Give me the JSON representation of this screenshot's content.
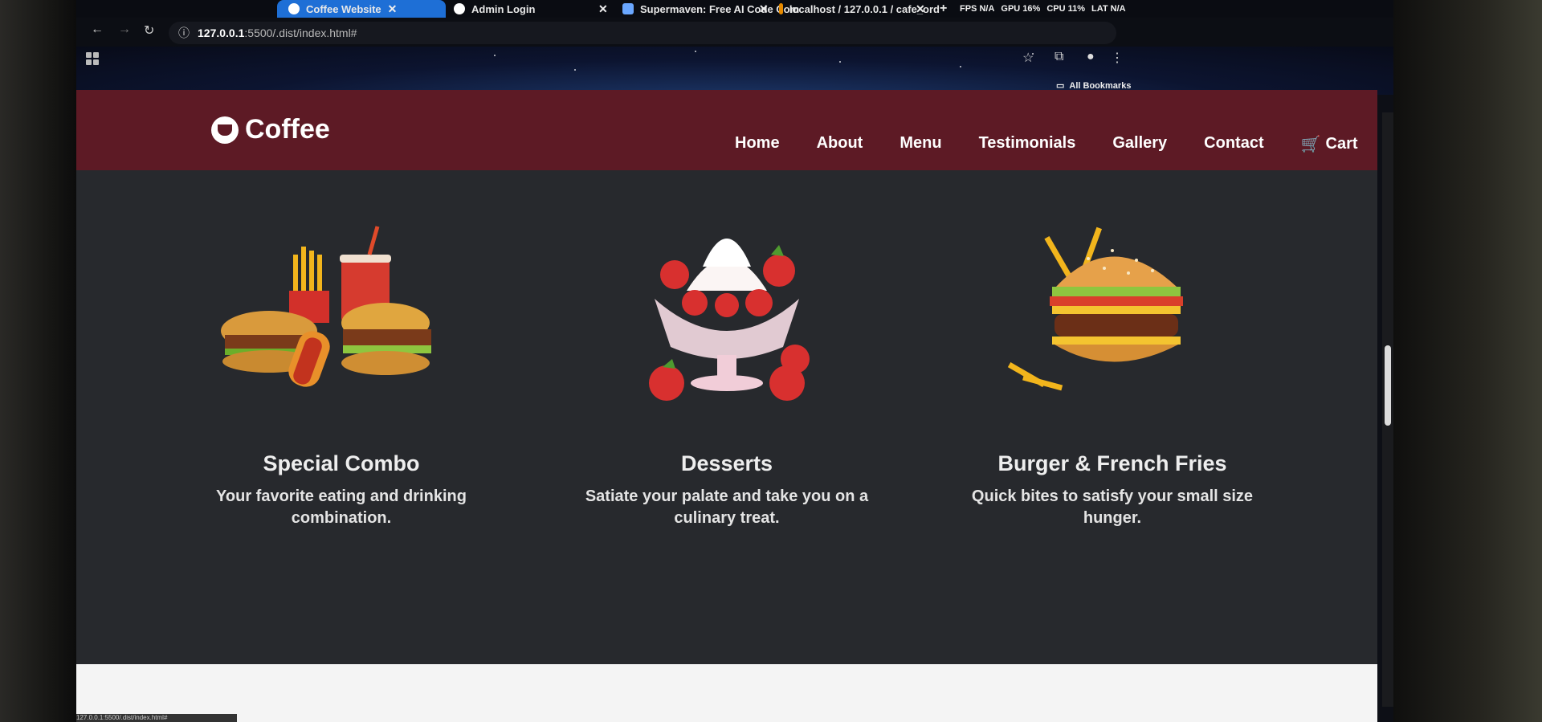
{
  "browser": {
    "tabs": [
      {
        "label": "Coffee Website",
        "active": true
      },
      {
        "label": "Admin Login",
        "active": false
      },
      {
        "label": "Supermaven: Free AI Code Com",
        "active": false
      },
      {
        "label": "localhost / 127.0.0.1 / cafe_ord",
        "active": false
      }
    ],
    "stats": {
      "fps": "FPS N/A",
      "gpu": "GPU 16%",
      "cpu": "CPU 11%",
      "lat": "LAT N/A"
    },
    "url_host": "127.0.0.1",
    "url_rest": ":5500/.dist/index.html#",
    "bookmarks_label": "All Bookmarks",
    "status_url": "127.0.0.1:5500/.dist/index.html#"
  },
  "site": {
    "brand": "Coffee",
    "nav": [
      "Home",
      "About",
      "Menu",
      "Testimonials",
      "Gallery",
      "Contact"
    ],
    "cart_label": "Cart",
    "cards": [
      {
        "title": "Special Combo",
        "text": "Your favorite eating and drinking combination.",
        "image": "combo-image"
      },
      {
        "title": "Desserts",
        "text": "Satiate your palate and take you on a culinary treat.",
        "image": "dessert-image"
      },
      {
        "title": "Burger & French Fries",
        "text": "Quick bites to satisfy your small size hunger.",
        "image": "burger-image"
      }
    ]
  },
  "colors": {
    "nav_bg": "#5d1a25",
    "page_bg": "#27292d",
    "tab_active": "#1e6fd6"
  }
}
